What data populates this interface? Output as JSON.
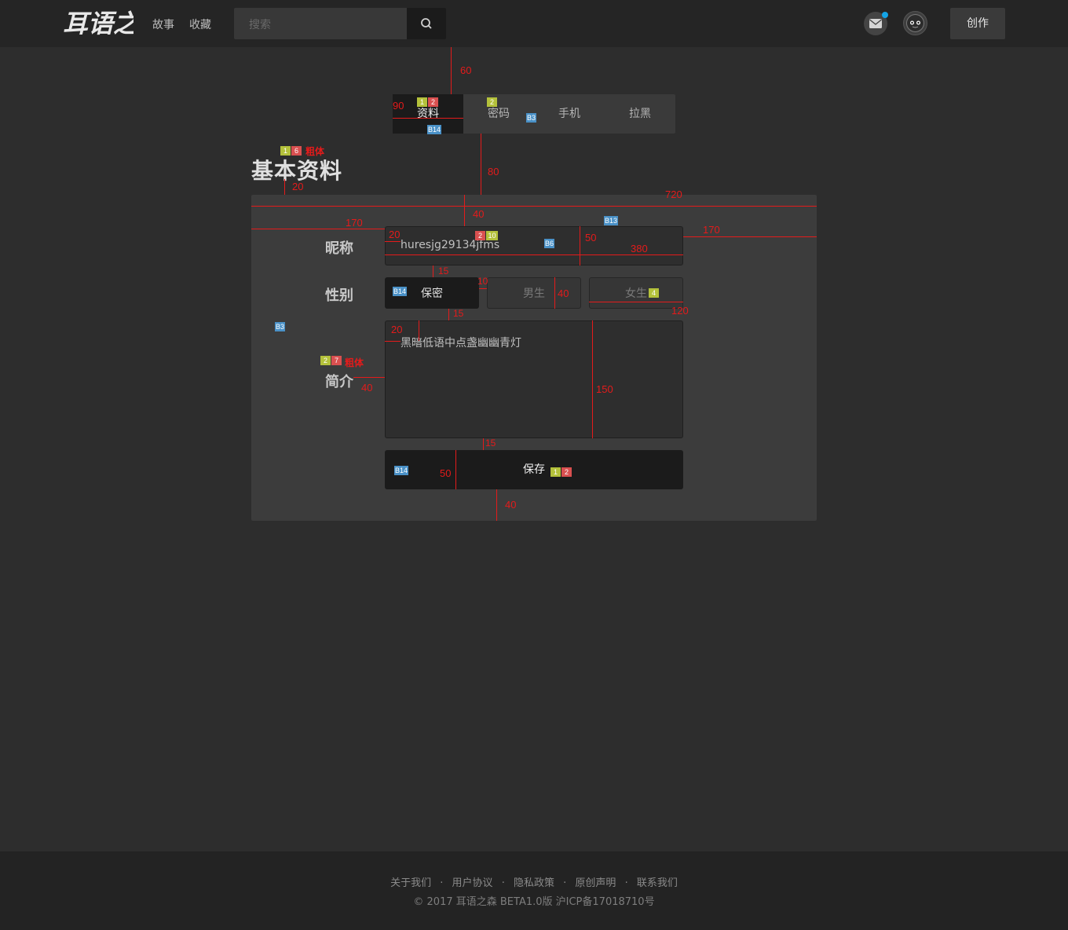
{
  "header": {
    "logo_text": "耳语之森",
    "nav": [
      "故事",
      "收藏"
    ],
    "search_placeholder": "搜索",
    "create_label": "创作"
  },
  "tabs": [
    "资料",
    "密码",
    "手机",
    "拉黑"
  ],
  "page_title": "基本资料",
  "form": {
    "nickname_label": "昵称",
    "nickname_value": "huresjg29134jfms",
    "gender_label": "性别",
    "gender_options": [
      "保密",
      "男生",
      "女生"
    ],
    "gender_selected": "保密",
    "intro_label": "简介",
    "intro_value": "黑暗低语中点盏幽幽青灯",
    "save_label": "保存"
  },
  "annotations": {
    "spacing": [
      "60",
      "90",
      "80",
      "20",
      "720",
      "40",
      "170",
      "20",
      "50",
      "380",
      "170",
      "15",
      "10",
      "40",
      "120",
      "15",
      "20",
      "40",
      "150",
      "15",
      "50",
      "40"
    ],
    "bold_note": "粗体",
    "tags": [
      "1",
      "2",
      "2",
      "B14",
      "B3",
      "1",
      "6",
      "2",
      "10",
      "B13",
      "B6",
      "B14",
      "4",
      "B3",
      "2",
      "7",
      "B14",
      "1",
      "2"
    ]
  },
  "footer": {
    "links": [
      "关于我们",
      "用户协议",
      "隐私政策",
      "原创声明",
      "联系我们"
    ],
    "separator": "·",
    "copyright": "© 2017  耳语之森  BETA1.0版  沪ICP备17018710号"
  },
  "colors": {
    "background": "#2d2d2d",
    "header": "#252525",
    "panel": "#3c3c3c",
    "dark_button": "#1b1b1b",
    "annotation_red": "#e41b1b",
    "notification_dot": "#14a4e6"
  }
}
